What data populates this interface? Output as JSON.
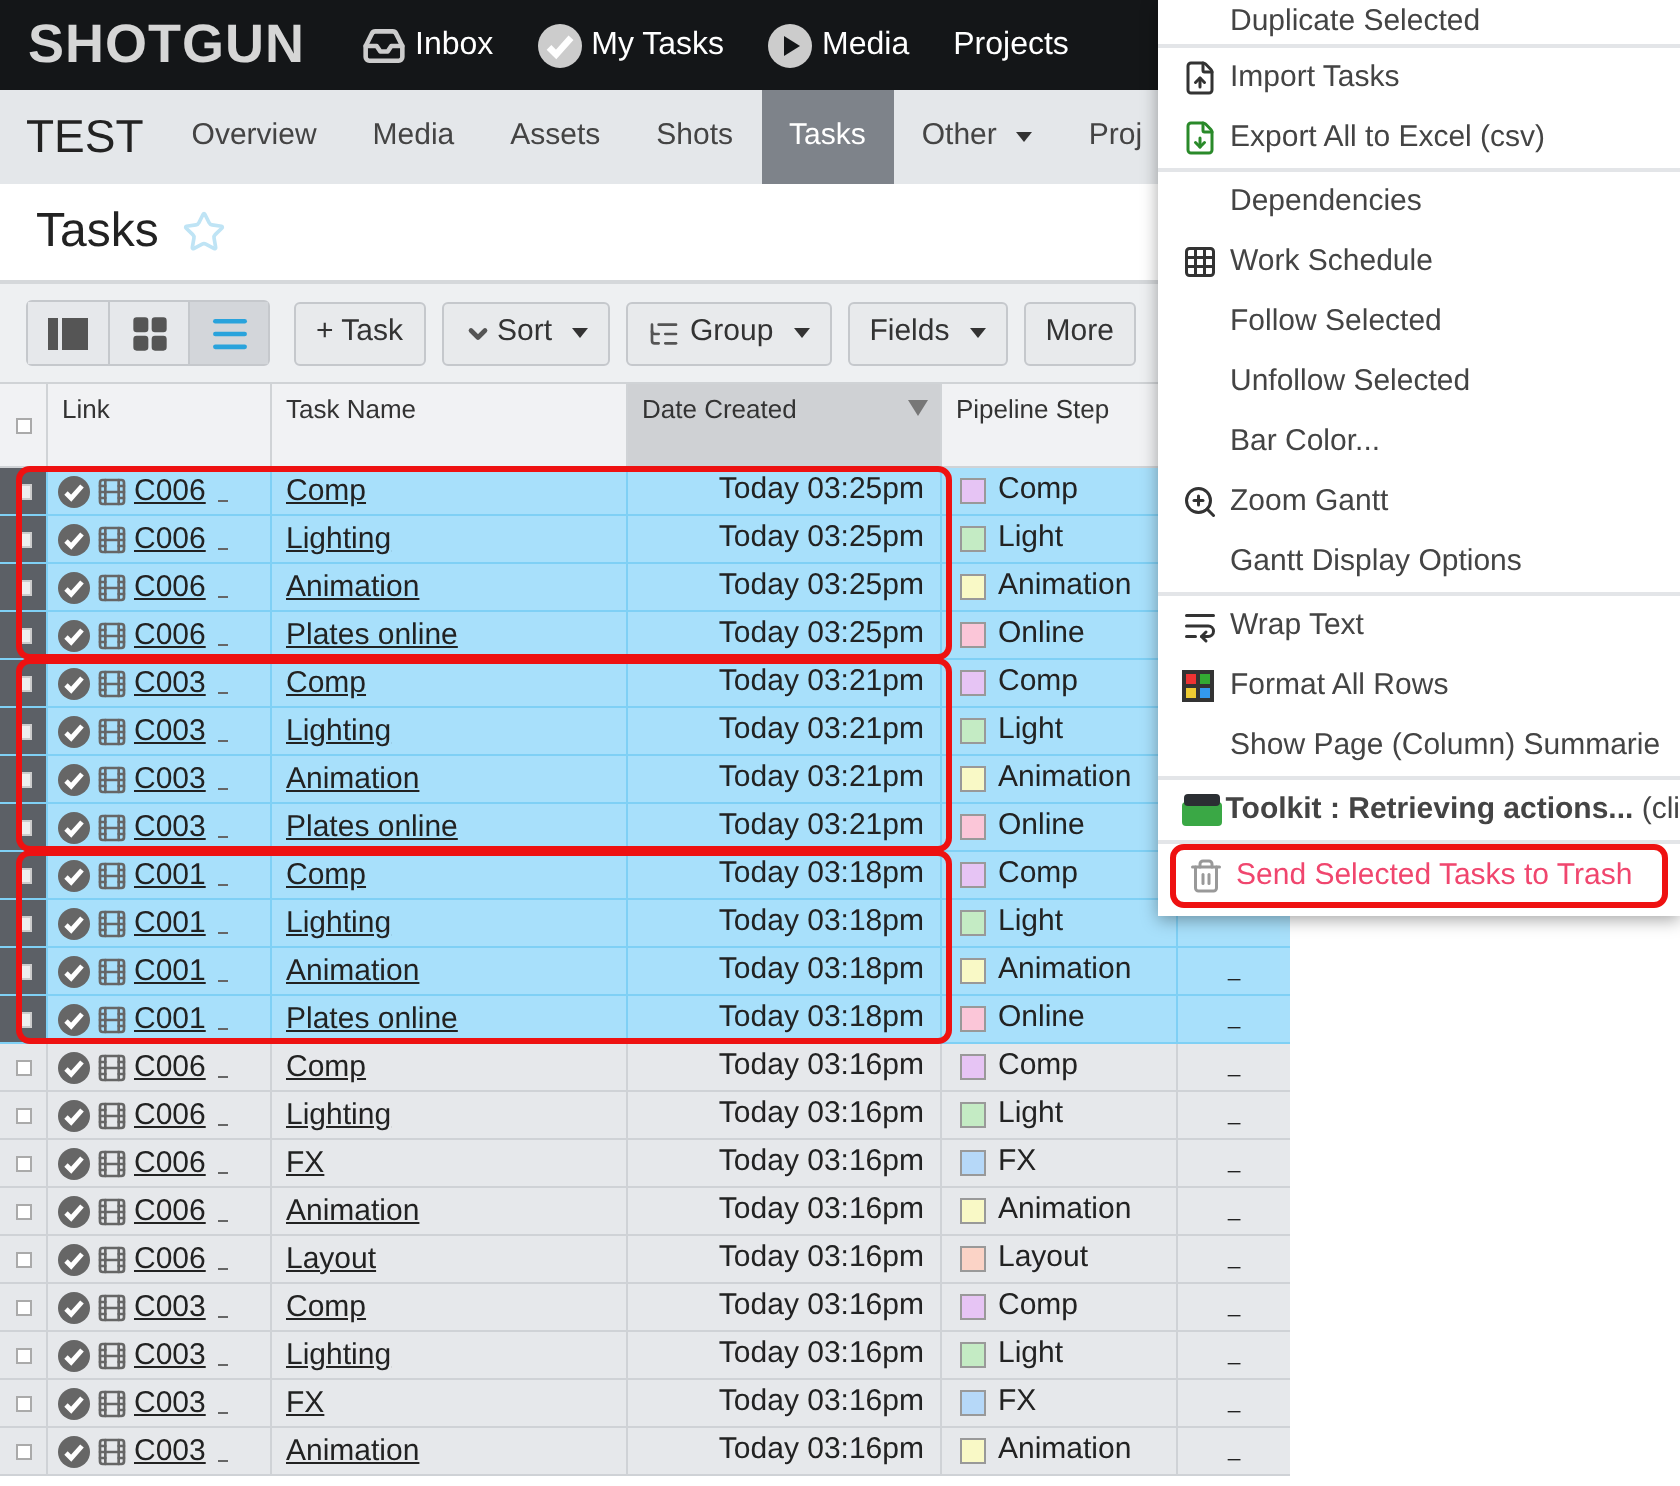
{
  "top_nav": {
    "logo": "SHOTGUN",
    "items": [
      {
        "kind": "inbox",
        "label": "Inbox"
      },
      {
        "kind": "tasks",
        "label": "My Tasks"
      },
      {
        "kind": "media",
        "label": "Media"
      },
      {
        "kind": "plain",
        "label": "Projects"
      }
    ]
  },
  "project_nav": {
    "project": "TEST",
    "tabs": [
      {
        "label": "Overview",
        "selected": false,
        "dropdown": false
      },
      {
        "label": "Media",
        "selected": false,
        "dropdown": false
      },
      {
        "label": "Assets",
        "selected": false,
        "dropdown": false
      },
      {
        "label": "Shots",
        "selected": false,
        "dropdown": false
      },
      {
        "label": "Tasks",
        "selected": true,
        "dropdown": false
      },
      {
        "label": "Other",
        "selected": false,
        "dropdown": true
      },
      {
        "label": "Proj",
        "selected": false,
        "dropdown": false
      }
    ]
  },
  "page": {
    "title": "Tasks",
    "favorite": false
  },
  "toolbar": {
    "views": [
      {
        "kind": "detail",
        "selected": false
      },
      {
        "kind": "grid",
        "selected": false
      },
      {
        "kind": "list",
        "selected": true
      }
    ],
    "buttons": [
      {
        "kind": "add",
        "label": "+ Task"
      },
      {
        "kind": "sort",
        "label": "Sort"
      },
      {
        "kind": "group",
        "label": "Group"
      },
      {
        "kind": "fields",
        "label": "Fields"
      },
      {
        "kind": "more",
        "label": "More"
      }
    ]
  },
  "table": {
    "select_all": {
      "checked": false
    },
    "columns": [
      {
        "label": "Link",
        "sorted": false
      },
      {
        "label": "Task Name",
        "sorted": false
      },
      {
        "label": "Date Created",
        "sorted": true
      },
      {
        "label": "Pipeline Step",
        "sorted": false
      }
    ],
    "row_groups": [
      {
        "outlined": true,
        "rows": [
          {
            "selected": true,
            "link": "C006",
            "task": "Comp",
            "date": "Today 03:25pm",
            "step": "Comp",
            "color": "#e6c4f4"
          },
          {
            "selected": true,
            "link": "C006",
            "task": "Lighting",
            "date": "Today 03:25pm",
            "step": "Light",
            "color": "#c4ebc4"
          },
          {
            "selected": true,
            "link": "C006",
            "task": "Animation",
            "date": "Today 03:25pm",
            "step": "Animation",
            "color": "#f9f9c6"
          },
          {
            "selected": true,
            "link": "C006",
            "task": "Plates online",
            "date": "Today 03:25pm",
            "step": "Online",
            "color": "#fbc6d8"
          }
        ]
      },
      {
        "outlined": true,
        "rows": [
          {
            "selected": true,
            "link": "C003",
            "task": "Comp",
            "date": "Today 03:21pm",
            "step": "Comp",
            "color": "#e6c4f4"
          },
          {
            "selected": true,
            "link": "C003",
            "task": "Lighting",
            "date": "Today 03:21pm",
            "step": "Light",
            "color": "#c4ebc4"
          },
          {
            "selected": true,
            "link": "C003",
            "task": "Animation",
            "date": "Today 03:21pm",
            "step": "Animation",
            "color": "#f9f9c6"
          },
          {
            "selected": true,
            "link": "C003",
            "task": "Plates online",
            "date": "Today 03:21pm",
            "step": "Online",
            "color": "#fbc6d8"
          }
        ]
      },
      {
        "outlined": true,
        "rows": [
          {
            "selected": true,
            "link": "C001",
            "task": "Comp",
            "date": "Today 03:18pm",
            "step": "Comp",
            "color": "#e6c4f4"
          },
          {
            "selected": true,
            "link": "C001",
            "task": "Lighting",
            "date": "Today 03:18pm",
            "step": "Light",
            "color": "#c4ebc4"
          },
          {
            "selected": true,
            "link": "C001",
            "task": "Animation",
            "date": "Today 03:18pm",
            "step": "Animation",
            "color": "#f9f9c6",
            "column_5": "_"
          },
          {
            "selected": true,
            "link": "C001",
            "task": "Plates online",
            "date": "Today 03:18pm",
            "step": "Online",
            "color": "#fbc6d8",
            "column_5": "_"
          }
        ]
      },
      {
        "rows": [
          {
            "selected": false,
            "link": "C006",
            "task": "Comp",
            "date": "Today 03:16pm",
            "step": "Comp",
            "color": "#e6c4f4",
            "column_5": "_"
          },
          {
            "selected": false,
            "link": "C006",
            "task": "Lighting",
            "date": "Today 03:16pm",
            "step": "Light",
            "color": "#c4ebc4",
            "column_5": "_"
          },
          {
            "selected": false,
            "link": "C006",
            "task": "FX",
            "date": "Today 03:16pm",
            "step": "FX",
            "color": "#b6d8f8",
            "column_5": "_"
          },
          {
            "selected": false,
            "link": "C006",
            "task": "Animation",
            "date": "Today 03:16pm",
            "step": "Animation",
            "color": "#f9f9c6",
            "column_5": "_"
          },
          {
            "selected": false,
            "link": "C006",
            "task": "Layout",
            "date": "Today 03:16pm",
            "step": "Layout",
            "color": "#fbd3c6",
            "column_5": "_"
          },
          {
            "selected": false,
            "link": "C003",
            "task": "Comp",
            "date": "Today 03:16pm",
            "step": "Comp",
            "color": "#e6c4f4",
            "column_5": "_"
          },
          {
            "selected": false,
            "link": "C003",
            "task": "Lighting",
            "date": "Today 03:16pm",
            "step": "Light",
            "color": "#c4ebc4",
            "column_5": "_"
          },
          {
            "selected": false,
            "link": "C003",
            "task": "FX",
            "date": "Today 03:16pm",
            "step": "FX",
            "color": "#b6d8f8",
            "column_5": "_"
          },
          {
            "selected": false,
            "link": "C003",
            "task": "Animation",
            "date": "Today 03:16pm",
            "step": "Animation",
            "color": "#f9f9c6",
            "column_5": "_"
          }
        ]
      }
    ]
  },
  "context_menu": {
    "sections": [
      [
        {
          "kind": "plain",
          "label": "Duplicate Selected",
          "danger": false,
          "outlined": false
        }
      ],
      [
        {
          "kind": "import",
          "label": "Import Tasks",
          "danger": false,
          "outlined": false
        },
        {
          "kind": "export",
          "label": "Export All to Excel (csv)",
          "danger": false,
          "outlined": false
        }
      ],
      [
        {
          "kind": "plain",
          "label": "Dependencies",
          "danger": false,
          "outlined": false
        },
        {
          "kind": "grid",
          "label": "Work Schedule",
          "danger": false,
          "outlined": false
        },
        {
          "kind": "plain",
          "label": "Follow Selected",
          "danger": false,
          "outlined": false
        },
        {
          "kind": "plain",
          "label": "Unfollow Selected",
          "danger": false,
          "outlined": false
        },
        {
          "kind": "plain",
          "label": "Bar Color...",
          "danger": false,
          "outlined": false
        },
        {
          "kind": "zoom",
          "label": "Zoom Gantt",
          "danger": false,
          "outlined": false
        },
        {
          "kind": "plain",
          "label": "Gantt Display Options",
          "danger": false,
          "outlined": false
        }
      ],
      [
        {
          "kind": "wrap",
          "label": "Wrap Text",
          "danger": false,
          "outlined": false
        },
        {
          "kind": "format",
          "label": "Format All Rows",
          "danger": false,
          "outlined": false
        },
        {
          "kind": "plain",
          "label": "Show Page (Column) Summarie",
          "danger": false,
          "outlined": false
        }
      ],
      [
        {
          "kind": "toolkit",
          "label": "**Toolkit : Retrieving actions...** (cli",
          "danger": false,
          "outlined": false
        }
      ],
      [
        {
          "kind": "trash",
          "label": "Send Selected Tasks to Trash",
          "danger": true,
          "outlined": true
        }
      ]
    ]
  }
}
